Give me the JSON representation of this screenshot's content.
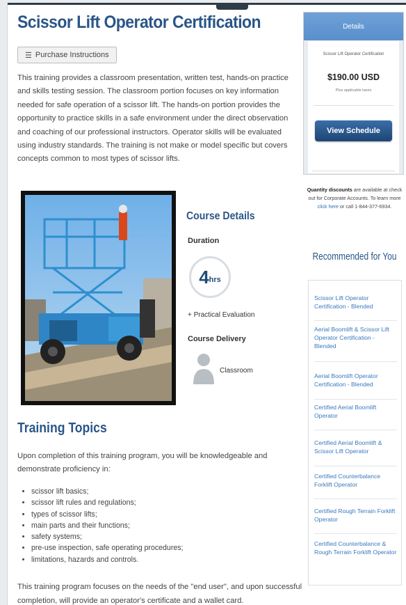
{
  "page": {
    "title": "Scissor Lift Operator Certification",
    "purchase_button": "Purchase Instructions",
    "intro": "This training provides a classroom presentation, written test, hands-on practice and skills testing session. The classroom portion focuses on key information needed for safe operation of a scissor lift. The hands-on portion provides the opportunity to practice skills in a safe environment under the direct observation and coaching of our professional instructors. Operator skills will be evaluated using industry standards. The training is not make or model specific but covers concepts common to most types of scissor lifts."
  },
  "course_details": {
    "title": "Course Details",
    "duration_label": "Duration",
    "duration_value": "4",
    "duration_unit": "hrs",
    "practical": "+ Practical Evaluation",
    "delivery_label": "Course Delivery",
    "delivery_value": "Classroom"
  },
  "topics": {
    "title": "Training Topics",
    "intro": "Upon completion of this training program, you will be knowledgeable and demonstrate proficiency in:",
    "items": [
      "scissor lift basics;",
      "scissor lift rules and regulations;",
      "types of scissor lifts;",
      "main parts and their functions;",
      "safety systems;",
      "pre-use inspection, safe operating procedures;",
      "limitations, hazards and controls."
    ],
    "outro": "This training program focuses on the needs of the \"end user\", and upon successful completion, will provide an operator's certificate and a wallet card."
  },
  "sidebar": {
    "header": "Details",
    "course_name": "Scissor Lift Operator Certification",
    "price": "$190.00 USD",
    "taxes": "Plus applicable taxes",
    "view_button": "View Schedule",
    "quantity": {
      "bold": "Quantity discounts",
      "text1": " are available at check out for Corporate Accounts. To learn more ",
      "link": "click here",
      "text2": " or call 1-844-377-6934."
    },
    "recommended_title": "Recommended for You",
    "recommended": [
      "Scissor Lift Operator Certification - Blended",
      "Aerial Boomlift & Scissor Lift Operator Certification - Blended",
      "Aerial Boomlift Operator Certification - Blended",
      "Certified Aerial Boomlift Operator",
      "Certified Aerial Boomlift & Scissor Lift Operator",
      "Certified Counterbalance Forklift Operator",
      "Certified Rough Terrain Forklift Operator",
      "Certified Counterbalance & Rough Terrain Forklift Operator"
    ]
  },
  "icons": {
    "purchase": "list-icon",
    "delivery": "person-icon"
  },
  "colors": {
    "heading": "#2a5688",
    "link": "#3a78bf",
    "button": "#1d4575"
  }
}
